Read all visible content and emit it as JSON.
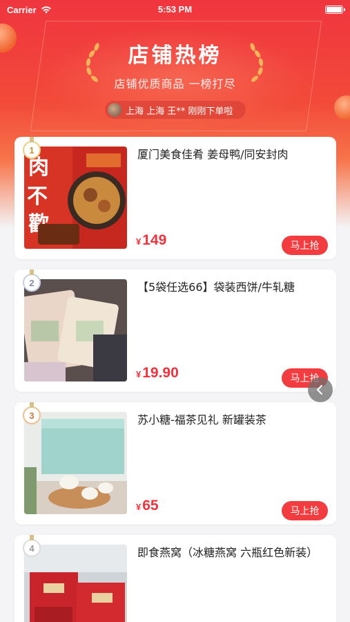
{
  "status_bar": {
    "carrier": "Carrier",
    "time": "5:53 PM"
  },
  "header": {
    "title": "店铺热榜",
    "subtitle": "店铺优质商品 一榜打尽",
    "ticker": "上海 上海 王** 刚刚下单啦"
  },
  "products": [
    {
      "rank": "1",
      "title": "厦门美食佳肴 姜母鸭/同安封肉",
      "currency": "¥",
      "price": "149",
      "button": "马上抢"
    },
    {
      "rank": "2",
      "title": "【5袋任选66】袋装西饼/牛轧糖",
      "currency": "¥",
      "price": "19.90",
      "button": "马上抢"
    },
    {
      "rank": "3",
      "title": "苏小糖-福茶见礼 新罐装茶",
      "currency": "¥",
      "price": "65",
      "button": "马上抢"
    },
    {
      "rank": "4",
      "title": "即食燕窝（冰糖燕窝 六瓶红色新装）",
      "currency": "",
      "price": "",
      "button": ""
    }
  ],
  "colors": {
    "brand_red": "#f23c3f",
    "price_red": "#f0323c",
    "hero_top": "#f0353f"
  },
  "icons": {
    "signal": "wifi-icon",
    "battery": "battery-icon",
    "back": "chevron-left-icon"
  }
}
